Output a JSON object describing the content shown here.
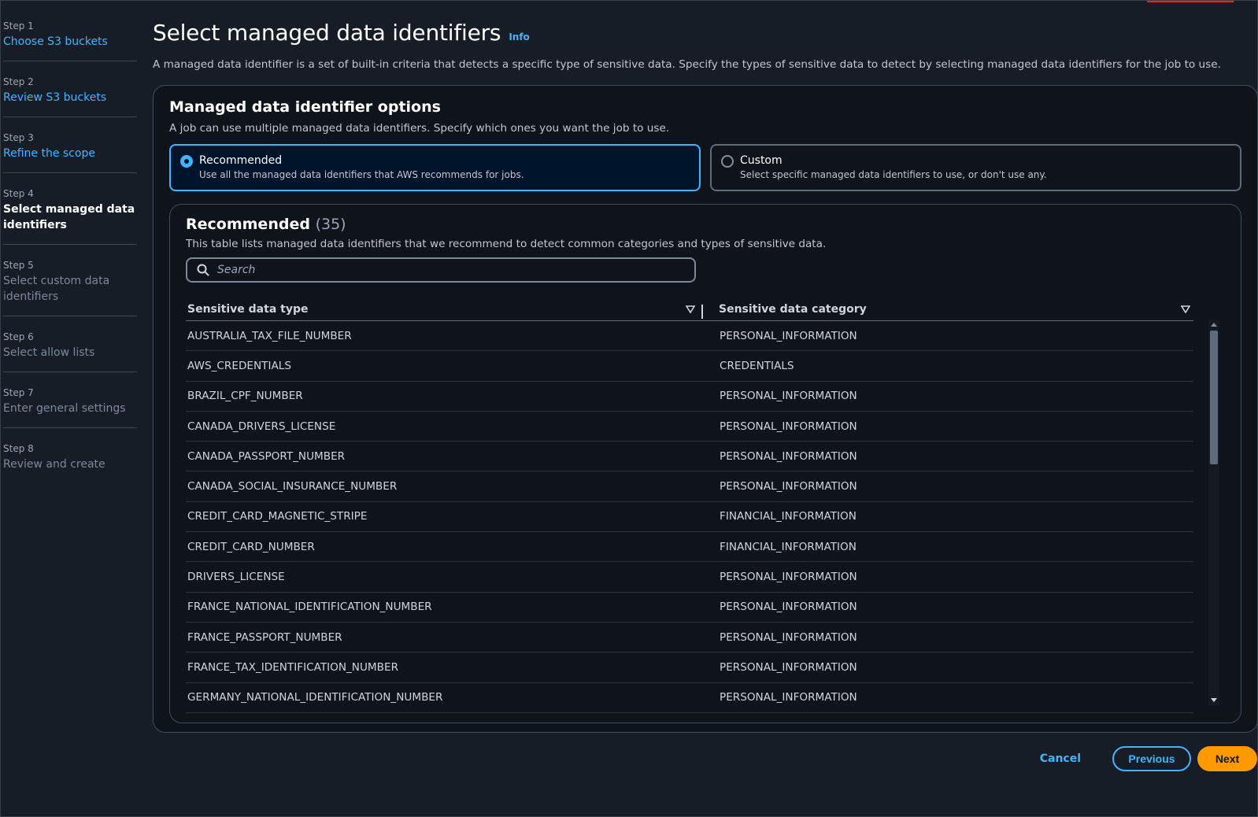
{
  "sidebar": {
    "steps": [
      {
        "num": "Step 1",
        "title": "Choose S3 buckets"
      },
      {
        "num": "Step 2",
        "title": "Review S3 buckets"
      },
      {
        "num": "Step 3",
        "title": "Refine the scope"
      },
      {
        "num": "Step 4",
        "title": "Select managed data identifiers"
      },
      {
        "num": "Step 5",
        "title": "Select custom data identifiers"
      },
      {
        "num": "Step 6",
        "title": "Select allow lists"
      },
      {
        "num": "Step 7",
        "title": "Enter general settings"
      },
      {
        "num": "Step 8",
        "title": "Review and create"
      }
    ]
  },
  "header": {
    "title": "Select managed data identifiers",
    "info": "Info",
    "description": "A managed data identifier is a set of built-in criteria that detects a specific type of sensitive data. Specify the types of sensitive data to detect by selecting managed data identifiers for the job to use."
  },
  "options": {
    "title": "Managed data identifier options",
    "description": "A job can use multiple managed data identifiers. Specify which ones you want the job to use.",
    "recommended": {
      "label": "Recommended",
      "description": "Use all the managed data identifiers that AWS recommends for jobs."
    },
    "custom": {
      "label": "Custom",
      "description": "Select specific managed data identifiers to use, or don't use any."
    },
    "selected": "Recommended"
  },
  "table": {
    "title": "Recommended",
    "count": "(35)",
    "description": "This table lists managed data identifiers that we recommend to detect common categories and types of sensitive data.",
    "search_placeholder": "Search",
    "columns": [
      "Sensitive data type",
      "Sensitive data category"
    ],
    "rows": [
      [
        "AUSTRALIA_TAX_FILE_NUMBER",
        "PERSONAL_INFORMATION"
      ],
      [
        "AWS_CREDENTIALS",
        "CREDENTIALS"
      ],
      [
        "BRAZIL_CPF_NUMBER",
        "PERSONAL_INFORMATION"
      ],
      [
        "CANADA_DRIVERS_LICENSE",
        "PERSONAL_INFORMATION"
      ],
      [
        "CANADA_PASSPORT_NUMBER",
        "PERSONAL_INFORMATION"
      ],
      [
        "CANADA_SOCIAL_INSURANCE_NUMBER",
        "PERSONAL_INFORMATION"
      ],
      [
        "CREDIT_CARD_MAGNETIC_STRIPE",
        "FINANCIAL_INFORMATION"
      ],
      [
        "CREDIT_CARD_NUMBER",
        "FINANCIAL_INFORMATION"
      ],
      [
        "DRIVERS_LICENSE",
        "PERSONAL_INFORMATION"
      ],
      [
        "FRANCE_NATIONAL_IDENTIFICATION_NUMBER",
        "PERSONAL_INFORMATION"
      ],
      [
        "FRANCE_PASSPORT_NUMBER",
        "PERSONAL_INFORMATION"
      ],
      [
        "FRANCE_TAX_IDENTIFICATION_NUMBER",
        "PERSONAL_INFORMATION"
      ],
      [
        "GERMANY_NATIONAL_IDENTIFICATION_NUMBER",
        "PERSONAL_INFORMATION"
      ]
    ]
  },
  "footer": {
    "cancel": "Cancel",
    "previous": "Previous",
    "next": "Next"
  },
  "colors": {
    "background": "#161d26",
    "link": "#42b4ff",
    "primary_button": "#ff9900",
    "selected_tile": "#00142b"
  },
  "icons": [
    "search-icon",
    "sort-caret-icon"
  ]
}
